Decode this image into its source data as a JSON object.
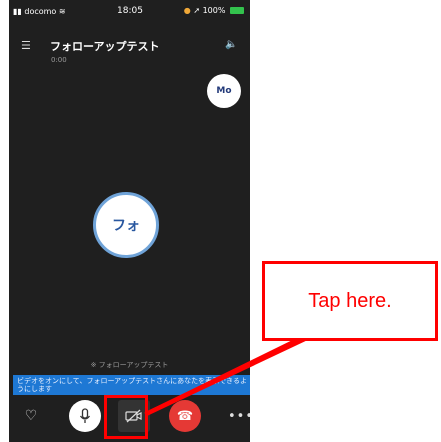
{
  "status_bar": {
    "carrier": "docomo",
    "time": "18:05",
    "battery": "100%"
  },
  "header": {
    "title": "フォローアップテスト",
    "duration": "0:00"
  },
  "participants": {
    "self_initials": "Mo",
    "remote_initials": "フォ"
  },
  "notice": {
    "caption": "※ フォローアップテスト",
    "banner": "ビデオをオンにして、フォローアップテストさんにあなたを表示できるようにします"
  },
  "callout": {
    "label": "Tap here."
  },
  "colors": {
    "highlight": "#ff0000",
    "banner": "#1e78d4",
    "hangup": "#e53935"
  }
}
